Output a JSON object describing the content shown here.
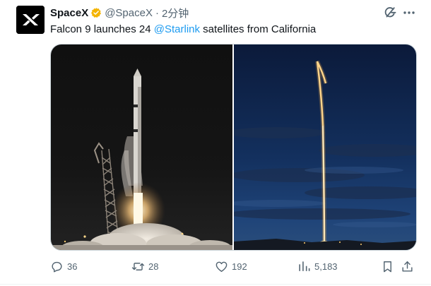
{
  "tweet": {
    "author_name": "SpaceX",
    "handle": "@SpaceX",
    "separator": "·",
    "time": "2分钟",
    "text_prefix": "Falcon 9 launches 24 ",
    "mention": "@Starlink",
    "text_suffix": " satellites from California",
    "icons": {
      "avatar": "spacex-logo",
      "verified": "verified-badge-icon",
      "grok": "grok-icon",
      "more": "more-icon"
    },
    "colors": {
      "link": "#1d9bf0",
      "verified": "#f4b400",
      "muted": "#536471"
    }
  },
  "media": {
    "photos": [
      {
        "subject": "night-launch-photo"
      },
      {
        "subject": "long-exposure-launch-photo"
      }
    ]
  },
  "actions": {
    "reply_count": "36",
    "retweet_count": "28",
    "like_count": "192",
    "views_count": "5,183"
  }
}
